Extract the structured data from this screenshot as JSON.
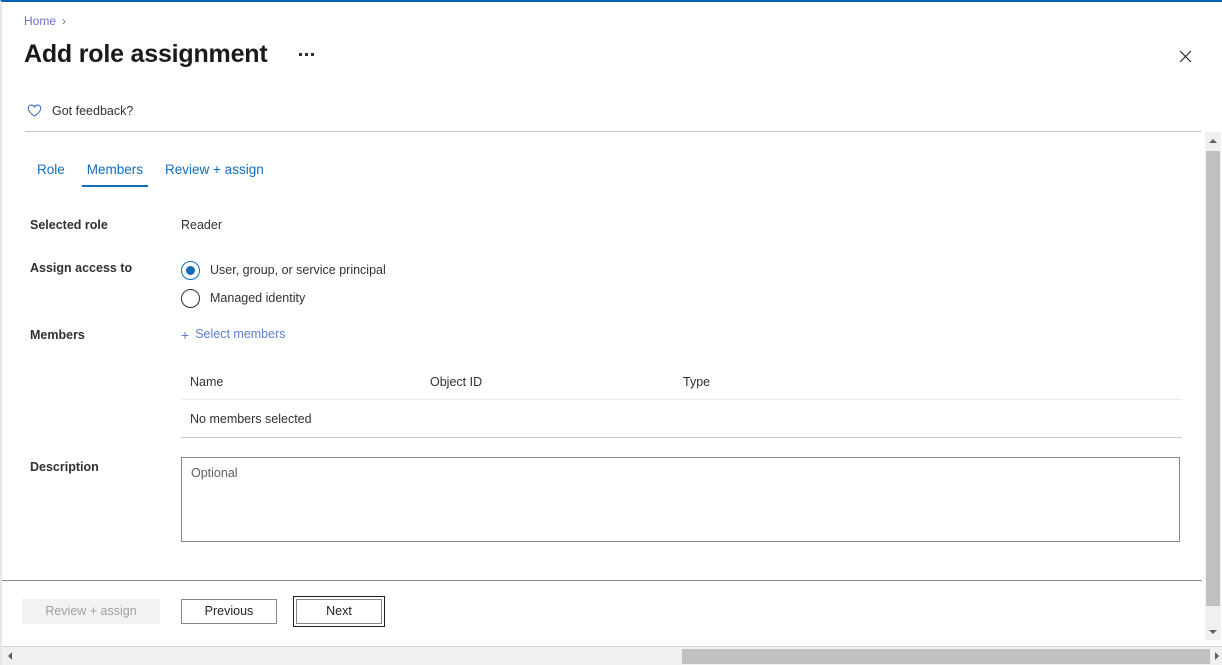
{
  "breadcrumb": {
    "home_label": "Home",
    "separator": "›"
  },
  "header": {
    "title": "Add role assignment",
    "more_actions_label": "···",
    "close_label": "✕"
  },
  "feedback": {
    "label": "Got feedback?",
    "icon": "heart-icon"
  },
  "tabs": [
    {
      "label": "Role",
      "active": false
    },
    {
      "label": "Members",
      "active": true
    },
    {
      "label": "Review + assign",
      "active": false
    }
  ],
  "form": {
    "selected_role": {
      "label": "Selected role",
      "value": "Reader"
    },
    "assign_access_to": {
      "label": "Assign access to",
      "options": [
        {
          "label": "User, group, or service principal",
          "checked": true
        },
        {
          "label": "Managed identity",
          "checked": false
        }
      ]
    },
    "members": {
      "label": "Members",
      "select_link": "Select members",
      "plus_icon": "+"
    },
    "description": {
      "label": "Description",
      "placeholder": "Optional",
      "value": ""
    }
  },
  "members_table": {
    "columns": [
      "Name",
      "Object ID",
      "Type"
    ],
    "empty_message": "No members selected",
    "rows": []
  },
  "footer": {
    "review_assign_label": "Review + assign",
    "previous_label": "Previous",
    "next_label": "Next"
  },
  "colors": {
    "accent": "#0f6cbd",
    "link": "#5b7fd4",
    "top_border": "#0063b1",
    "text": "#323130",
    "disabled_text": "#a19f9d",
    "scrollbar_thumb": "#c1c1c1"
  }
}
